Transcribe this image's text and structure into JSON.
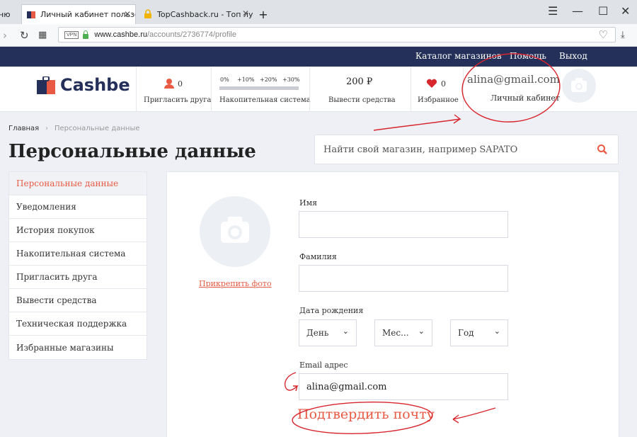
{
  "browser": {
    "tabs": [
      {
        "label": "ню",
        "active": false
      },
      {
        "label": "Личный кабинет пользо",
        "active": true
      },
      {
        "label": "TopCashback.ru - Топ лучш",
        "active": false
      }
    ],
    "new_tab_glyph": "+",
    "url_host": "www.cashbe.ru",
    "url_path": "/accounts/2736774/profile",
    "vpn_label": "VPN"
  },
  "site": {
    "top_nav": [
      "Каталог магазинов",
      "Помощь",
      "Выход"
    ],
    "logo": "Cashbe",
    "header": {
      "invite_count": "0",
      "invite_label": "Пригласить друга",
      "accum_levels": [
        "0%",
        "+10%",
        "+20%",
        "+30%"
      ],
      "accum_label": "Накопительная система",
      "balance": "200 ₽",
      "withdraw_label": "Вывести средства",
      "favorites_count": "0",
      "favorites_label": "Избранное",
      "user_email": "alina@gmail.com",
      "cabinet_label": "Личный кабинет"
    },
    "breadcrumb": [
      "Главная",
      "Персональные данные"
    ],
    "page_title": "Персональные данные",
    "search_placeholder": "Найти свой магазин, например SAPATO",
    "sidebar": [
      "Персональные данные",
      "Уведомления",
      "История покупок",
      "Накопительная система",
      "Пригласить друга",
      "Вывести средства",
      "Техническая поддержка",
      "Избранные магазины"
    ],
    "form": {
      "attach_photo": "Прикрепить фото",
      "first_name_label": "Имя",
      "first_name_value": "",
      "last_name_label": "Фамилия",
      "last_name_value": "",
      "birthdate_label": "Дата рождения",
      "day_placeholder": "День",
      "month_placeholder": "Мес...",
      "year_placeholder": "Год",
      "email_label": "Email адрес",
      "email_value": "alina@gmail.com",
      "confirm_email": "Подтвердить почту"
    }
  },
  "colors": {
    "navy": "#24305a",
    "accent": "#e85a44",
    "annotation": "#d8262e"
  }
}
